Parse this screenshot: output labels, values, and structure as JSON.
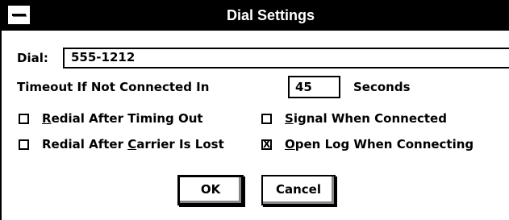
{
  "window": {
    "title": "Dial Settings"
  },
  "dial": {
    "label": "Dial:",
    "value": "555-1212"
  },
  "timeout": {
    "label": "Timeout If Not Connected In",
    "value": "45",
    "unit": "Seconds"
  },
  "options": {
    "redial_timeout": {
      "label_mnemonic": "R",
      "label_rest": "edial After Timing Out",
      "checked": false
    },
    "redial_carrier": {
      "label_pre": "Redial After ",
      "label_mnemonic": "C",
      "label_rest": "arrier Is Lost",
      "checked": false
    },
    "signal_connected": {
      "label_mnemonic": "S",
      "label_rest": "ignal When Connected",
      "checked": false
    },
    "open_log": {
      "label_mnemonic": "O",
      "label_rest": "pen Log When Connecting",
      "checked": true,
      "mark": "X"
    }
  },
  "buttons": {
    "ok": "OK",
    "cancel": "Cancel"
  }
}
